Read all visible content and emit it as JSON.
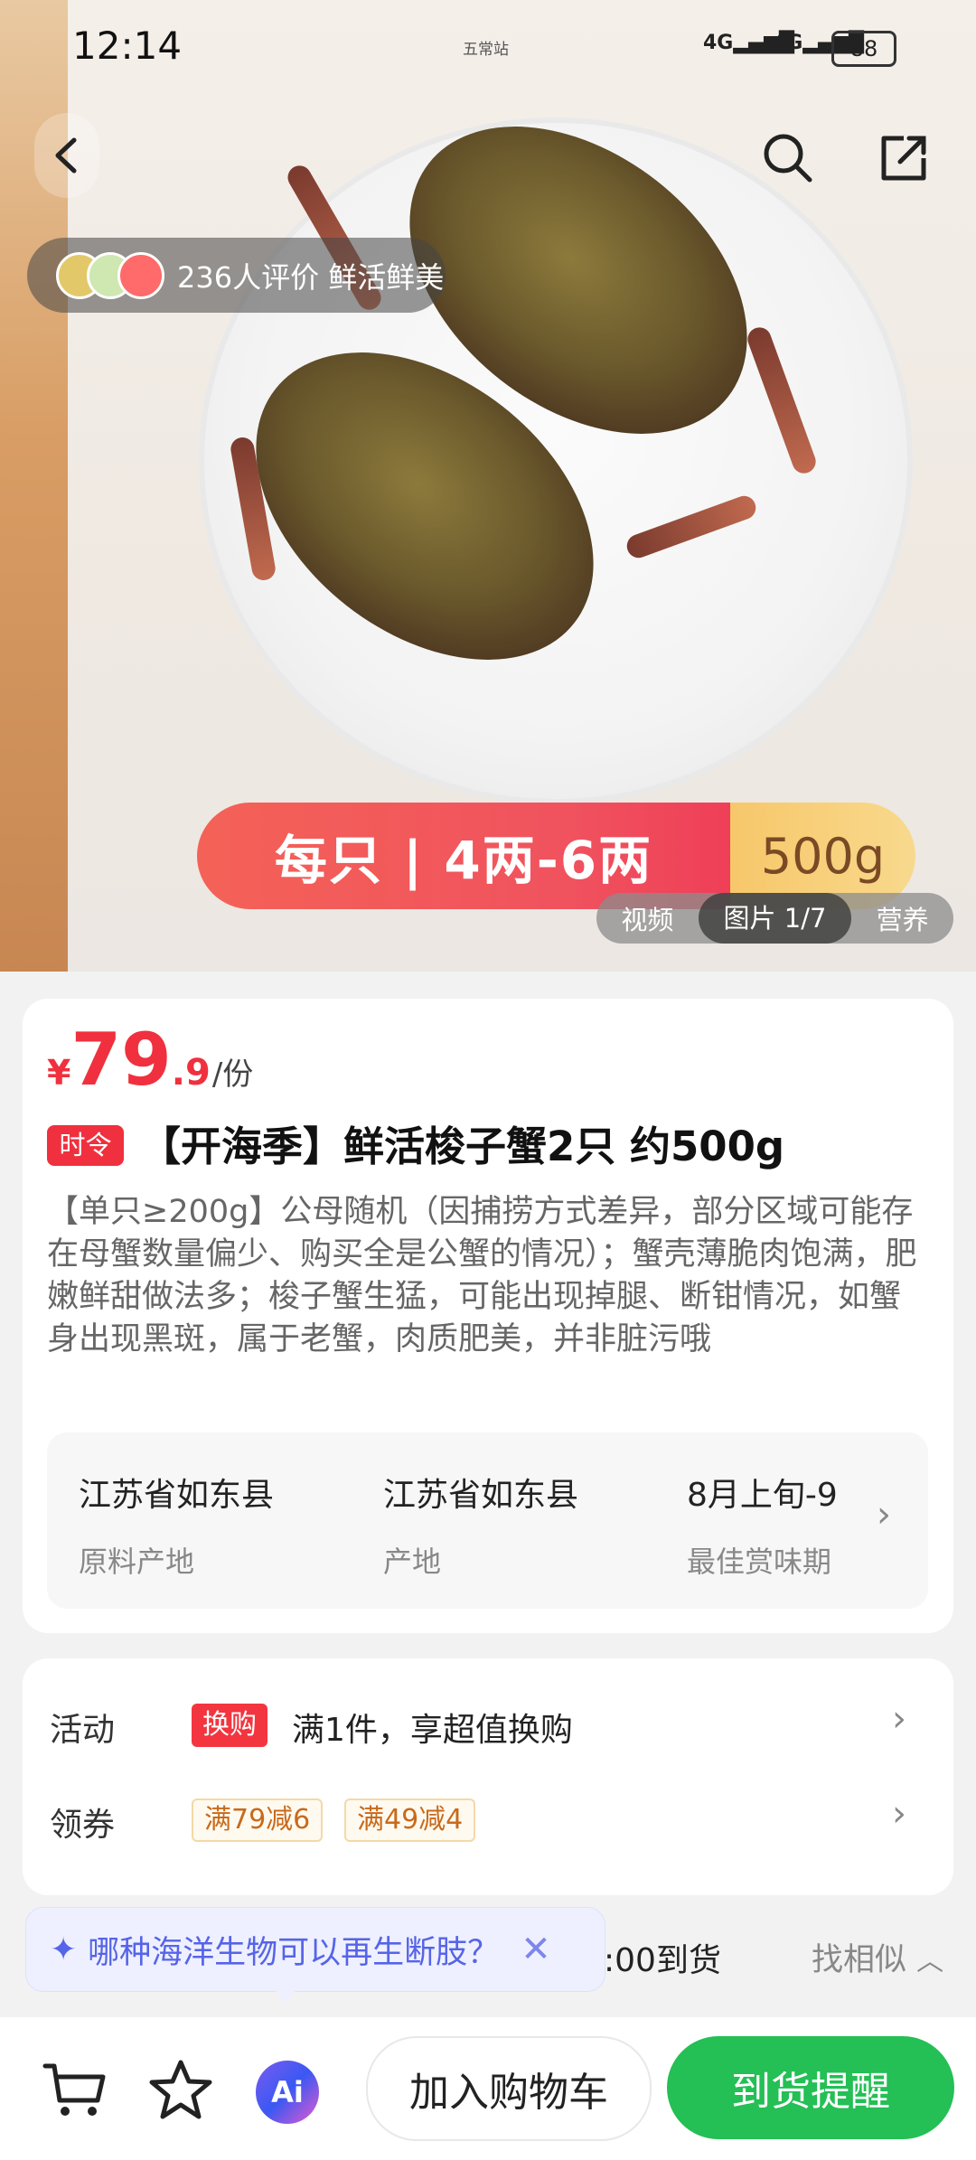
{
  "status_bar": {
    "time": "12:14",
    "carrier": "五常站",
    "signal1": "4G",
    "signal2": "4G",
    "battery": "88"
  },
  "hero": {
    "review_text": "236人评价 鲜活鲜美",
    "spec_left": "每只 | 4两-6两",
    "spec_right": "500g",
    "media_tabs": {
      "video": "视频",
      "images": "图片 1/7",
      "nutrition": "营养"
    }
  },
  "product": {
    "currency": "¥",
    "price_int": "79",
    "price_dec": ".9",
    "price_unit": "/份",
    "tag": "时令",
    "title": "【开海季】鲜活梭子蟹2只 约500g",
    "description": "【单只≥200g】公母随机（因捕捞方式差异，部分区域可能存在母蟹数量偏少、购买全是公蟹的情况）；蟹壳薄脆肉饱满，肥嫩鲜甜做法多；梭子蟹生猛，可能出现掉腿、断钳情况，如蟹身出现黑斑，属于老蟹，肉质肥美，并非脏污哦",
    "origin": [
      {
        "value": "江苏省如东县",
        "label": "原料产地"
      },
      {
        "value": "江苏省如东县",
        "label": "产地"
      },
      {
        "value": "8月上旬-9",
        "label": "最佳赏味期"
      }
    ]
  },
  "promotions": {
    "activity_label": "活动",
    "activity_badge": "换购",
    "activity_text": "满1件，享超值换购",
    "coupon_label": "领券",
    "coupons": [
      "满79减6",
      "满49减4"
    ]
  },
  "ai_tip": {
    "text": "哪种海洋生物可以再生断肢？"
  },
  "arrival_text": ":00到货",
  "similar": "找相似",
  "bottom": {
    "add_cart": "加入购物车",
    "notify": "到货提醒",
    "ai": "Ai"
  }
}
